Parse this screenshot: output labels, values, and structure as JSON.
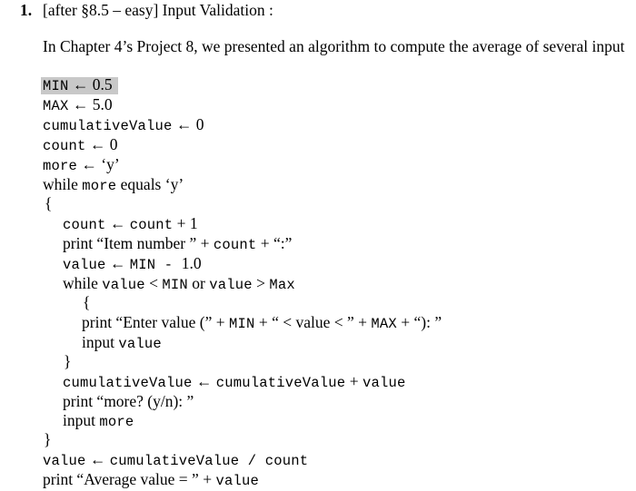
{
  "problem": {
    "number": "1.",
    "header": "[after §8.5 – easy] Input Validation :",
    "intro": "In Chapter 4’s Project 8, we presented an algorithm to compute the average of several input"
  },
  "code": {
    "l1": {
      "a": "MIN",
      "b": " ← 0.5"
    },
    "l2": {
      "a": "MAX",
      "b": " ← 5.0"
    },
    "l3": {
      "a": "cumulativeValue",
      "b": " ← 0"
    },
    "l4": {
      "a": "count",
      "b": " ← 0"
    },
    "l5": {
      "a": "more",
      "b": " ← ‘y’"
    },
    "l6": {
      "a": "while ",
      "b": "more",
      "c": " equals ‘y’"
    },
    "l7": {
      "a": "{"
    },
    "l8": {
      "a": "count",
      "b": " ← ",
      "c": "count",
      "d": " + 1"
    },
    "l9": {
      "a": "print “Item number ”  +  ",
      "b": "count",
      "c": " + “:”"
    },
    "l10": {
      "a": "value",
      "b": " ← ",
      "c": "MIN - ",
      "d": "1.0"
    },
    "l11": {
      "a": "while ",
      "b": "value",
      "c": " < ",
      "d": "MIN",
      "e": "  or ",
      "f": "value",
      "g": " > ",
      "h": "Max"
    },
    "l12": {
      "a": "{"
    },
    "l13": {
      "a": "print “Enter value (” + ",
      "b": "MIN",
      "c": " + “ < value < ” + ",
      "d": "MAX",
      "e": " + “): ”"
    },
    "l14": {
      "a": "input ",
      "b": "value"
    },
    "l15": {
      "a": "}"
    },
    "l16": {
      "a": "cumulativeValue",
      "b": " ← ",
      "c": "cumulativeValue",
      "d": " + ",
      "e": "value"
    },
    "l17": {
      "a": "print “more? (y/n): ”"
    },
    "l18": {
      "a": "input ",
      "b": "more"
    },
    "l19": {
      "a": "}"
    },
    "l20": {
      "a": "value",
      "b": " ← ",
      "c": "cumulativeValue / count"
    },
    "l21": {
      "a": "print “Average value = ” + ",
      "b": "value"
    }
  },
  "highlight_color": "#c8c8c8"
}
